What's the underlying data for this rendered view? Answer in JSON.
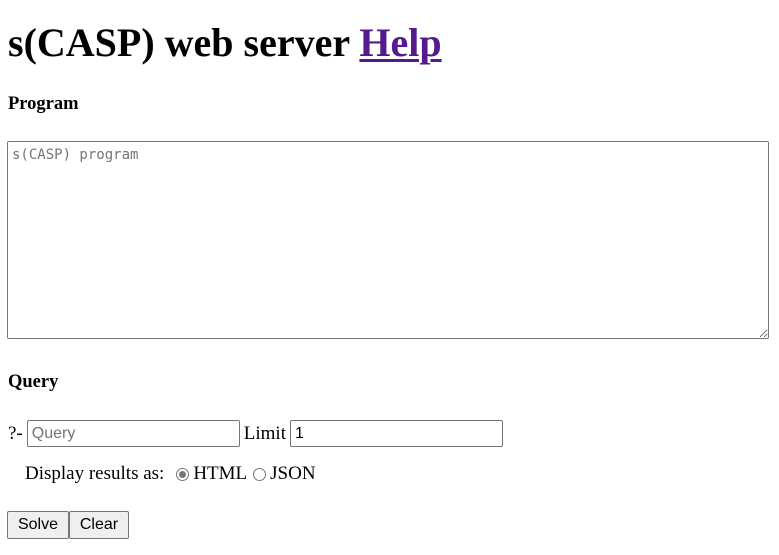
{
  "header": {
    "title": "s(CASP) web server",
    "help_link": "Help"
  },
  "program": {
    "heading": "Program",
    "placeholder": "s(CASP) program",
    "value": ""
  },
  "query": {
    "heading": "Query",
    "prompt": "?-",
    "input_placeholder": "Query",
    "input_value": "",
    "limit_label": "Limit",
    "limit_value": "1"
  },
  "display": {
    "label": "Display results as:",
    "options": [
      {
        "label": "HTML",
        "selected": true
      },
      {
        "label": "JSON",
        "selected": false
      }
    ]
  },
  "actions": {
    "solve_label": "Solve",
    "clear_label": "Clear"
  },
  "colors": {
    "link": "#551a8b",
    "border": "#767676",
    "button_bg": "#efefef"
  }
}
